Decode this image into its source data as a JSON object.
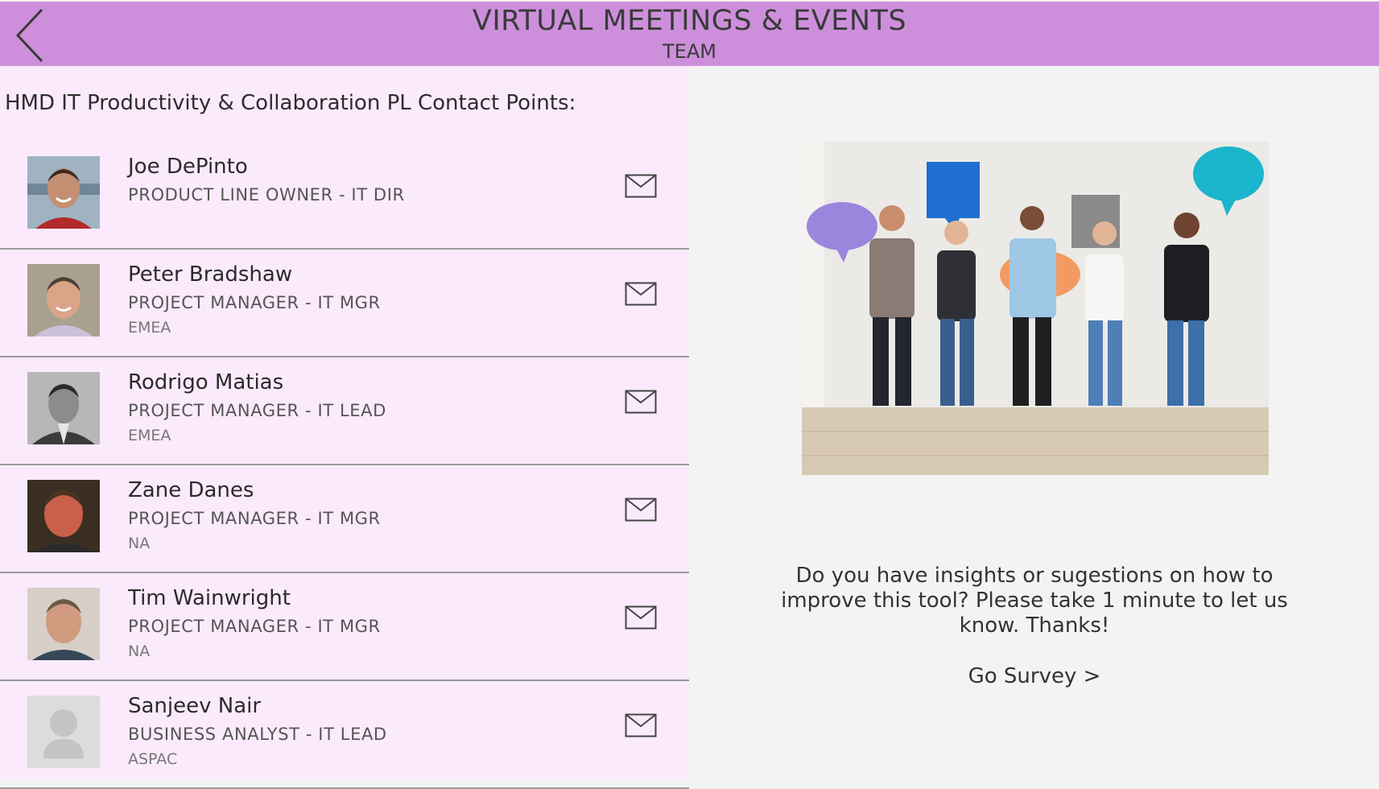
{
  "header": {
    "title": "VIRTUAL MEETINGS & EVENTS",
    "subtitle": "TEAM",
    "back_icon": "chevron-left-icon",
    "color": "#cd8fdb"
  },
  "section": {
    "title": "HMD IT Productivity & Collaboration PL Contact Points:"
  },
  "contacts": [
    {
      "name": "Joe DePinto",
      "role": "PRODUCT LINE OWNER - IT DIR",
      "region": ""
    },
    {
      "name": "Peter Bradshaw",
      "role": "PROJECT MANAGER - IT MGR",
      "region": "EMEA"
    },
    {
      "name": "Rodrigo Matias",
      "role": "PROJECT MANAGER - IT LEAD",
      "region": "EMEA"
    },
    {
      "name": "Zane Danes",
      "role": "PROJECT MANAGER - IT MGR",
      "region": "NA"
    },
    {
      "name": "Tim Wainwright",
      "role": "PROJECT MANAGER - IT MGR",
      "region": "NA"
    },
    {
      "name": "Sanjeev Nair",
      "role": "BUSINESS ANALYST - IT LEAD",
      "region": "ASPAC"
    }
  ],
  "survey": {
    "text": "Do you have insights or sugestions on how to improve this tool? Please take 1 minute to let us know. Thanks!",
    "link_label": "Go Survey >"
  },
  "colors": {
    "left_panel_bg": "#fbeafc",
    "right_panel_bg": "#f3f3f3"
  }
}
